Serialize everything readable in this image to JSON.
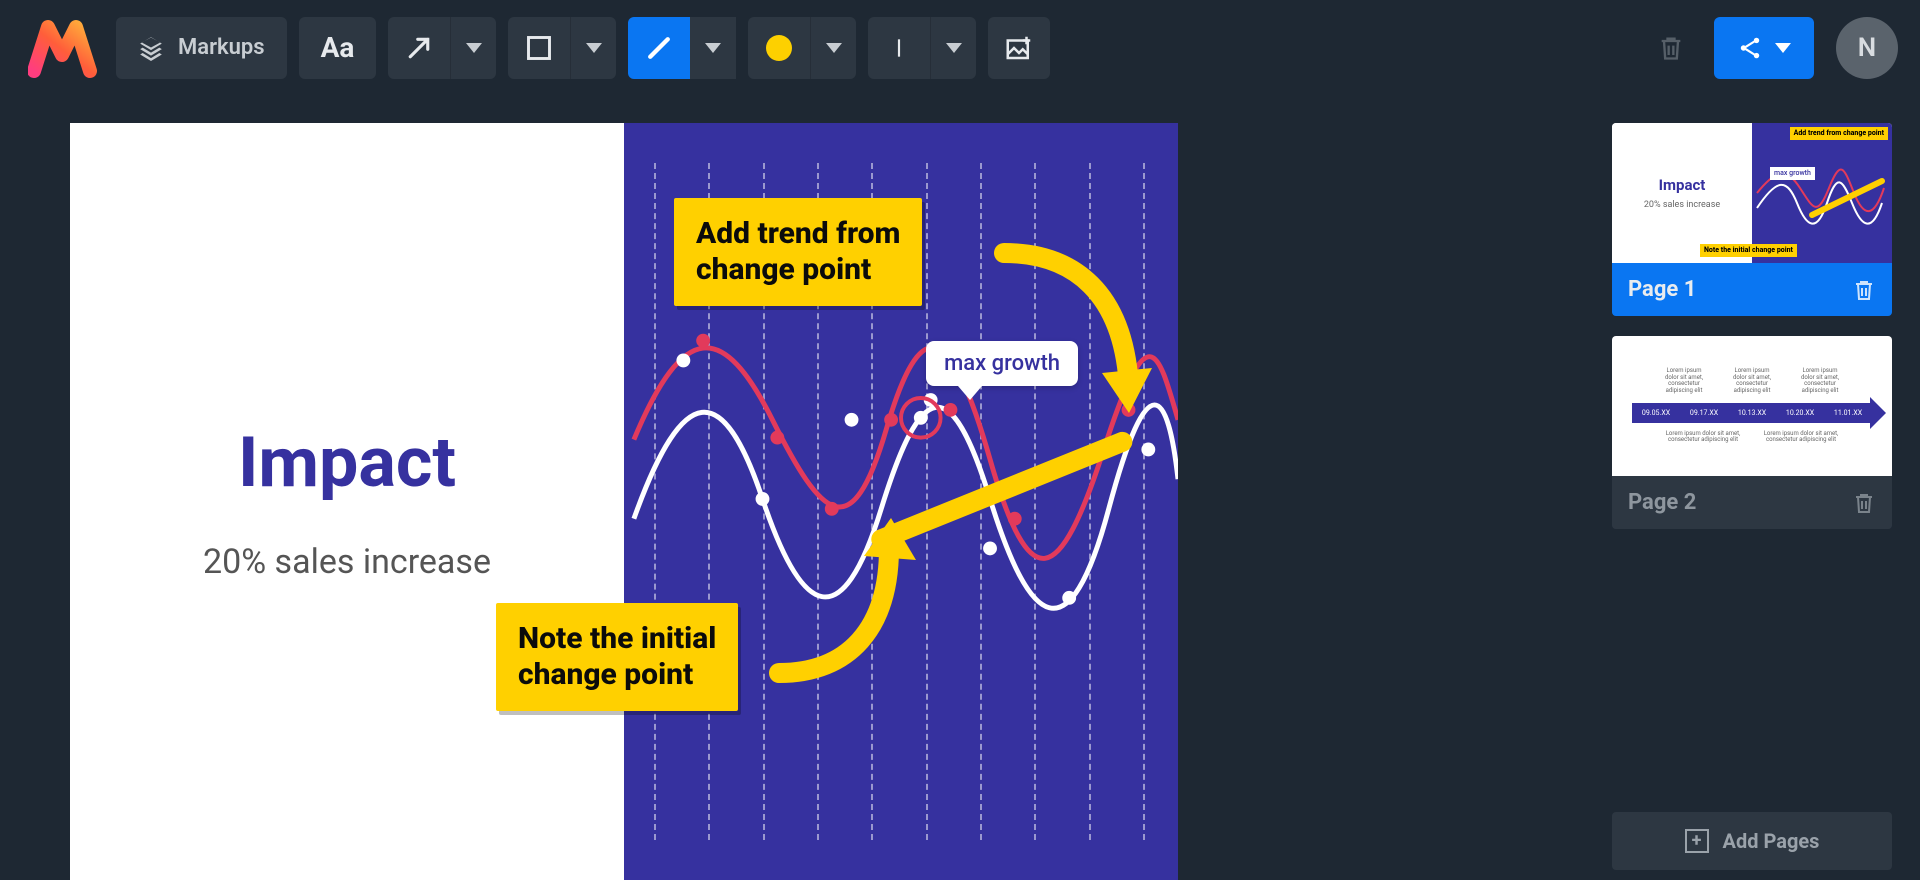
{
  "toolbar": {
    "markups_label": "Markups",
    "text_tool_glyph": "Aa",
    "avatar_initial": "N"
  },
  "slide": {
    "title": "Impact",
    "subtitle": "20% sales increase",
    "max_growth_label": "max growth"
  },
  "annotations": {
    "top": {
      "line1": "Add trend from",
      "line2": "change point"
    },
    "bottom": {
      "line1": "Note the initial",
      "line2": "change point"
    }
  },
  "pages": {
    "page1_label": "Page 1",
    "page2_label": "Page 2",
    "add_pages": "Add Pages"
  },
  "thumb1": {
    "title": "Impact",
    "sub": "20% sales increase",
    "top_sticky": "Add trend from\nchange point",
    "bottom_sticky": "Note the initial\nchange point",
    "max": "max growth"
  },
  "thumb2": {
    "lorem": "Lorem ipsum dolor sit amet, consectetur adipiscing elit",
    "dates": [
      "09.05.XX",
      "09.17.XX",
      "10.13.XX",
      "10.20.XX",
      "11.01.XX"
    ]
  },
  "colors": {
    "accent": "#0a76f2",
    "annotation_yellow": "#ffd000",
    "slide_blue": "#36319f"
  }
}
